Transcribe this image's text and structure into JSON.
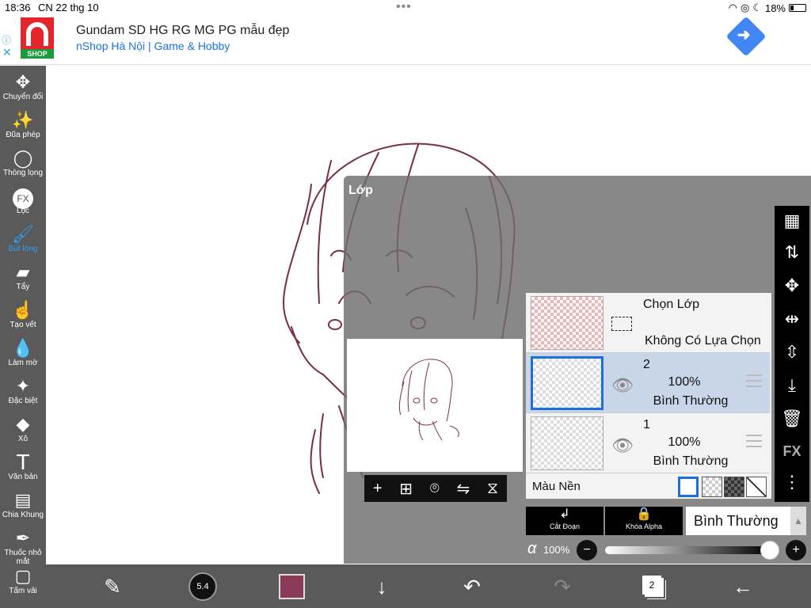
{
  "status_bar": {
    "time": "18:36",
    "date": "CN 22 thg 10",
    "battery": "18%",
    "battery_level": 0.18
  },
  "ad": {
    "title": "Gundam SD HG RG MG PG mẫu đẹp",
    "subtitle": "nShop Hà Nội | Game & Hobby",
    "logo_text": "SHOP"
  },
  "toolbar": {
    "items": [
      {
        "label": "Chuyển đổi",
        "icon": "move-icon"
      },
      {
        "label": "Đũa phép",
        "icon": "magic-wand-icon"
      },
      {
        "label": "Thòng lọng",
        "icon": "lasso-icon"
      },
      {
        "label": "Lọc",
        "icon": "fx-filter-icon",
        "glyph": "FX"
      },
      {
        "label": "Bút lông",
        "icon": "brush-icon",
        "active": true
      },
      {
        "label": "Tẩy",
        "icon": "eraser-icon"
      },
      {
        "label": "Tạo vết",
        "icon": "smudge-icon"
      },
      {
        "label": "Làm mờ",
        "icon": "blur-icon"
      },
      {
        "label": "Đặc biệt",
        "icon": "special-icon"
      },
      {
        "label": "Xô",
        "icon": "bucket-icon"
      },
      {
        "label": "Văn bản",
        "icon": "text-icon",
        "glyph": "T"
      },
      {
        "label": "Chia Khung",
        "icon": "frame-divider-icon"
      },
      {
        "label": "Thuốc nhỏ mắt",
        "icon": "eyedropper-icon"
      },
      {
        "label": "Tấm vải",
        "icon": "canvas-icon"
      }
    ],
    "active_color": "#2f9ef2"
  },
  "bottom_bar": {
    "brush_size": "5.4",
    "color": "#8b3b57",
    "layer_count": "2"
  },
  "layer_panel": {
    "title": "Lớp",
    "selection_layer": {
      "title": "Chọn Lớp",
      "status": "Không Có Lựa Chọn"
    },
    "layers": [
      {
        "name": "2",
        "opacity": "100%",
        "mode": "Bình Thường",
        "selected": true
      },
      {
        "name": "1",
        "opacity": "100%",
        "mode": "Bình Thường",
        "selected": false
      }
    ],
    "background_label": "Màu Nền",
    "clip_label": "Cắt Đoạn",
    "alpha_lock_label": "Khóa Alpha",
    "blend_mode": "Bình Thường",
    "alpha_symbol": "α",
    "opacity_value": "100%",
    "opacity_level": 1.0,
    "right_icons": [
      "checkerboard-icon",
      "swap-layer-icon",
      "move-layer-icon",
      "flip-horizontal-icon",
      "flip-vertical-icon",
      "merge-down-icon",
      "trash-icon",
      "fx-icon",
      "more-icon"
    ],
    "fx_label": "FX"
  },
  "colors": {
    "stroke": "#7a2e44",
    "toolbar": "#5a5a5a",
    "selected_layer": "#c9d6ea",
    "selection_border": "#1e6fd9"
  }
}
